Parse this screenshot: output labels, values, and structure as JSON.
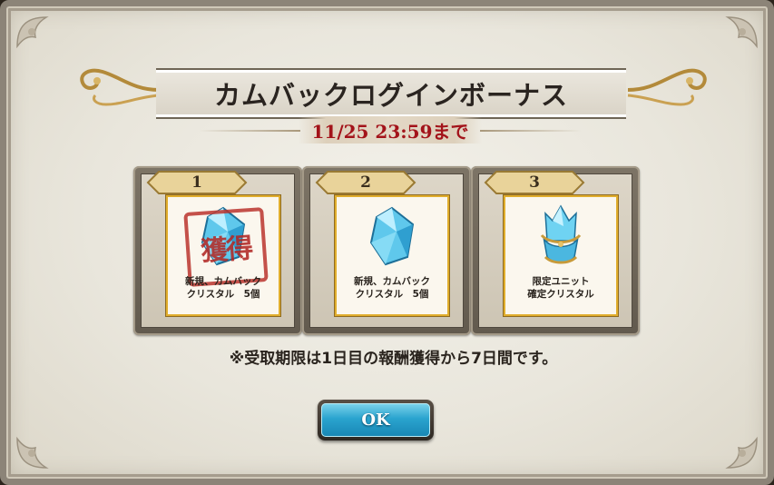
{
  "dialog": {
    "title": "カムバックログインボーナス",
    "deadline": "11/25 23:59まで",
    "notice": "※受取期限は1日目の報酬獲得から7日間です。",
    "ok_label": "OK"
  },
  "rewards": [
    {
      "day": "1",
      "label_line1": "新規、カムバック",
      "label_line2": "クリスタル　5個",
      "icon": "crystal-icon",
      "claimed": true,
      "stamp": "獲得"
    },
    {
      "day": "2",
      "label_line1": "新規、カムバック",
      "label_line2": "クリスタル　5個",
      "icon": "crystal-icon",
      "claimed": false
    },
    {
      "day": "3",
      "label_line1": "限定ユニット",
      "label_line2": "確定クリスタル",
      "icon": "limited-crystal-icon",
      "claimed": false
    }
  ],
  "colors": {
    "deadline": "#a3131a",
    "stamp": "#b02824",
    "button": "#2aa4cf",
    "reward_border": "#e0ad2c"
  }
}
